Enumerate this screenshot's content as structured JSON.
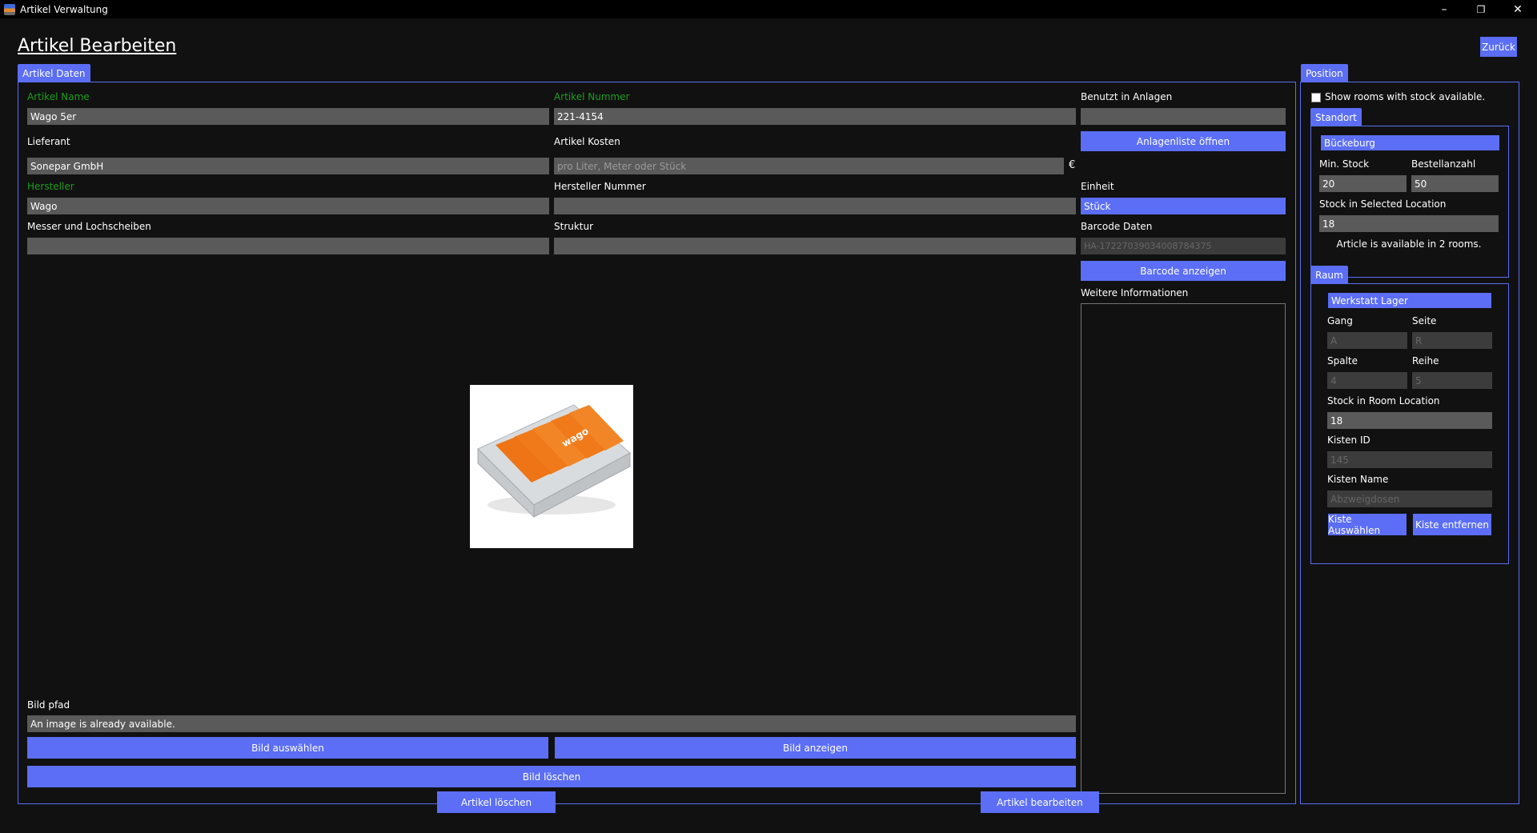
{
  "window": {
    "title": "Artikel Verwaltung",
    "minimize": "–",
    "restore": "❐",
    "close": "✕"
  },
  "page": {
    "title": "Artikel Bearbeiten",
    "back_label": "Zurück"
  },
  "artikel_daten": {
    "tab_label": "Artikel Daten",
    "name_label": "Artikel Name",
    "name_value": "Wago 5er",
    "nummer_label": "Artikel Nummer",
    "nummer_value": "221-4154",
    "benutzt_label": "Benutzt in Anlagen",
    "benutzt_value": "",
    "lieferant_label": "Lieferant",
    "lieferant_value": "Sonepar GmbH",
    "kosten_label": "Artikel Kosten",
    "kosten_placeholder": "pro Liter, Meter oder Stück",
    "currency": "€",
    "anlagenliste_button": "Anlagenliste öffnen",
    "hersteller_label": "Hersteller",
    "hersteller_value": "Wago",
    "hersteller_nummer_label": "Hersteller Nummer",
    "hersteller_nummer_value": "",
    "einheit_label": "Einheit",
    "einheit_value": "Stück",
    "messer_label": "Messer und Lochscheiben",
    "messer_value": "",
    "struktur_label": "Struktur",
    "struktur_value": "",
    "barcode_label": "Barcode Daten",
    "barcode_value": "HA-17227039034008784375",
    "barcode_button": "Barcode anzeigen",
    "weitere_label": "Weitere Informationen",
    "bild_pfad_label": "Bild pfad",
    "bild_pfad_value": "An image is already available.",
    "bild_auswaehlen": "Bild auswählen",
    "bild_anzeigen": "Bild anzeigen",
    "bild_loeschen": "Bild löschen",
    "image_text": "wago"
  },
  "position": {
    "tab_label": "Position",
    "show_rooms_label": "Show rooms with stock available.",
    "standort": {
      "tab_label": "Standort",
      "selected": "Bückeburg",
      "min_stock_label": "Min. Stock",
      "min_stock_value": "20",
      "bestellanzahl_label": "Bestellanzahl",
      "bestellanzahl_value": "50",
      "stock_selected_label": "Stock in Selected Location",
      "stock_selected_value": "18",
      "availability_text": "Article is available in 2 rooms."
    },
    "raum": {
      "tab_label": "Raum",
      "selected": "Werkstatt Lager",
      "gang_label": "Gang",
      "gang_value": "A",
      "seite_label": "Seite",
      "seite_value": "R",
      "spalte_label": "Spalte",
      "spalte_value": "4",
      "reihe_label": "Reihe",
      "reihe_value": "5",
      "stock_room_label": "Stock in Room Location",
      "stock_room_value": "18",
      "kisten_id_label": "Kisten ID",
      "kisten_id_value": "145",
      "kisten_name_label": "Kisten Name",
      "kisten_name_value": "Abzweigdosen",
      "kiste_auswaehlen": "Kiste Auswählen",
      "kiste_entfernen": "Kiste entfernen"
    }
  },
  "footer": {
    "loeschen": "Artikel löschen",
    "bearbeiten": "Artikel bearbeiten"
  },
  "colors": {
    "accent": "#5b6ef5",
    "required_label": "#1e9e1e",
    "background": "#111111",
    "input": "#5a5a5a"
  }
}
